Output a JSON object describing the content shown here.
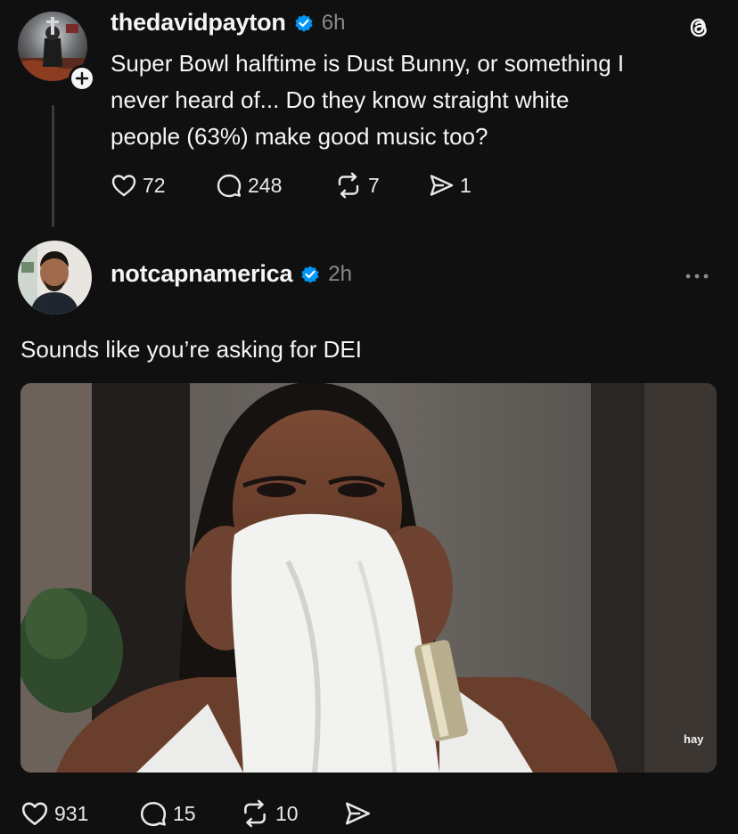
{
  "post1": {
    "username": "thedavidpayton",
    "time": "6h",
    "text_lines": [
      "Super Bowl halftime is Dust Bunny, or something I",
      "never heard of... Do they know straight white",
      "people (63%) make good music too?"
    ],
    "likes": "72",
    "replies": "248",
    "reposts": "7",
    "shares": "1"
  },
  "post2": {
    "username": "notcapnamerica",
    "time": "2h",
    "text": "Sounds like you’re asking for DEI",
    "media_watermark": "hay",
    "likes": "931",
    "replies": "15",
    "reposts": "10"
  },
  "colors": {
    "background": "#101010",
    "text": "#f3f5f7",
    "muted": "#8a8a8a",
    "verified": "#0095f6"
  },
  "icons": [
    "threads-logo-icon",
    "follow-plus-icon",
    "verified-badge-icon",
    "heart-icon",
    "comment-icon",
    "repost-icon",
    "share-icon",
    "more-icon"
  ]
}
